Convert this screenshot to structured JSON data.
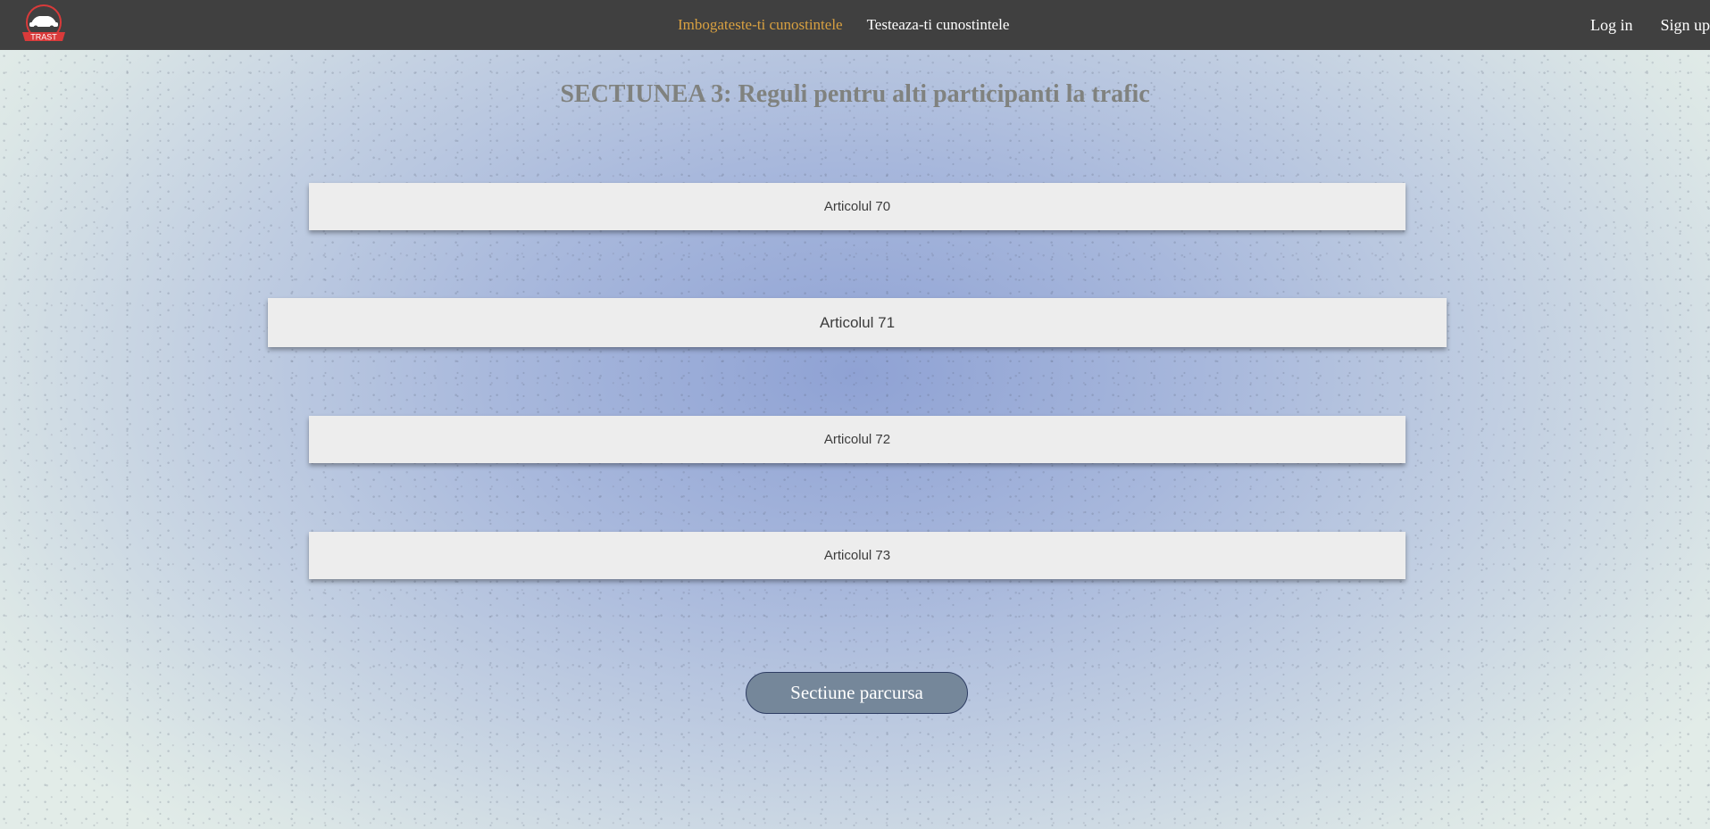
{
  "nav": {
    "logo_icon": "car-logo-icon",
    "logo_text": "TRAST",
    "links": [
      {
        "label": "Imbogateste-ti cunostintele",
        "active": true
      },
      {
        "label": "Testeaza-ti cunostintele",
        "active": false
      }
    ],
    "auth": {
      "login_label": "Log in",
      "signup_label": "Sign up"
    },
    "active_color": "#d8a040",
    "background": "#404040"
  },
  "main": {
    "title": "SECTIUNEA 3: Reguli pentru alti participanti la trafic",
    "articles": [
      {
        "label": "Articolul 70"
      },
      {
        "label": "Articolul 71"
      },
      {
        "label": "Articolul 72"
      },
      {
        "label": "Articolul 73"
      }
    ],
    "done_button_label": "Sectiune parcursa"
  }
}
